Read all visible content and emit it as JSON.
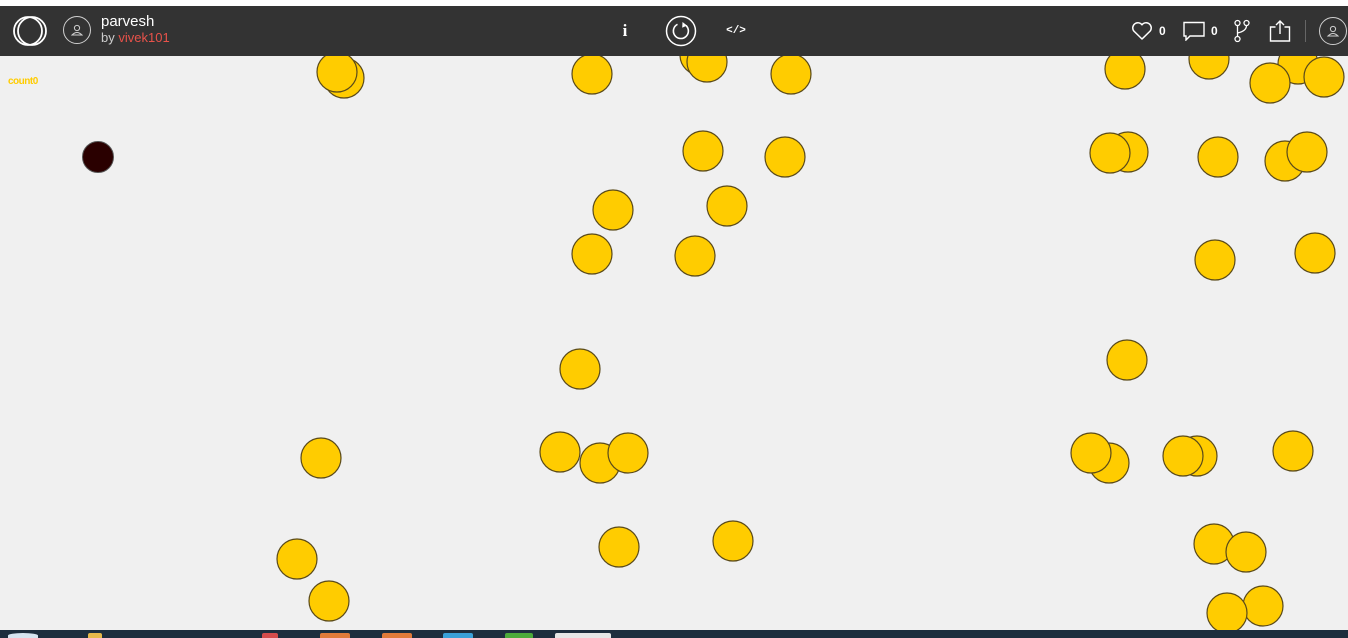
{
  "header": {
    "title": "parvesh",
    "by_prefix": "by",
    "author": "vivek101",
    "info_label": "i",
    "code_label": "</>",
    "likes": "0",
    "comments": "0"
  },
  "game": {
    "counter_text": "count0",
    "coin_color": "#ffcc00",
    "player_color": "#2a0000"
  },
  "colors": {
    "topbar": "#333333",
    "author": "#e8524a",
    "canvas_bg": "#f0f0f0"
  }
}
